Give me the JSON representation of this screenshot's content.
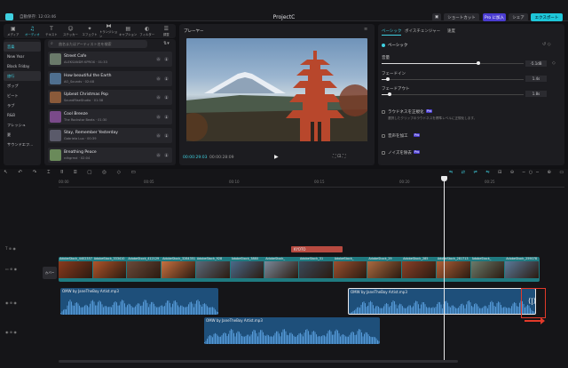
{
  "topbar": {
    "autosave": "自動保存: 12:03:46",
    "title": "ProjectC",
    "shortcut": "ショートカット",
    "pro": "Pro に加入",
    "share": "シェア",
    "export": "エクスポート"
  },
  "tools": [
    {
      "label": "メディア",
      "icon": "media-icon"
    },
    {
      "label": "オーディオ",
      "icon": "audio-icon"
    },
    {
      "label": "テキスト",
      "icon": "text-icon"
    },
    {
      "label": "ステッカー",
      "icon": "sticker-icon"
    },
    {
      "label": "エフェクト",
      "icon": "effect-icon"
    },
    {
      "label": "トランジション",
      "icon": "transition-icon"
    },
    {
      "label": "キャプション",
      "icon": "caption-icon"
    },
    {
      "label": "フィルター",
      "icon": "filter-icon"
    },
    {
      "label": "調整",
      "icon": "adjust-icon"
    }
  ],
  "categories": [
    "音楽",
    "New Year",
    "Black Friday",
    "旅行",
    "ポップ",
    "ビート",
    "ラブ",
    "R&B",
    "フレッシュ",
    "夏",
    "サウンドエフ..."
  ],
  "search_placeholder": "曲名またはアーティスト名を検索",
  "tracks": [
    {
      "title": "Street Cafe",
      "artist": "ALEKSANDR KPROX · 01:33",
      "color": "#6a7a6a"
    },
    {
      "title": "How beautiful the Earth",
      "artist": "AO_Sounds · 02:48",
      "color": "#4f6f8f"
    },
    {
      "title": "Upbeat Christmas Pop",
      "artist": "SoundRiseStudio · 01:38",
      "color": "#8a5a3a"
    },
    {
      "title": "Cool Breeze",
      "artist": "The Rockstar Beats · 01:30",
      "color": "#7a4a8a"
    },
    {
      "title": "Stay, Remember Yesterday",
      "artist": "Gabriela Luo · 00:39",
      "color": "#5a5a6a"
    },
    {
      "title": "Breathing Peace",
      "artist": "rdhgrmd · 02:04",
      "color": "#6a8a5a"
    }
  ],
  "player": {
    "title": "プレーヤー",
    "current": "00:00:29:03",
    "total": "00:00:28:09"
  },
  "props": {
    "tabs": [
      "ベーシック",
      "ボイスチェンジャー",
      "速度"
    ],
    "section": "ベーシック",
    "volume_label": "音量",
    "volume_value": "-5.1dB",
    "fadein_label": "フェードイン",
    "fadein_value": "1.4s",
    "fadeout_label": "フェードアウト",
    "fadeout_value": "1.8s",
    "ducking_label": "ラウドネスを正規化",
    "ducking_desc": "選択したクリップのラウドネスを標準レベルに正規化します。",
    "enhance_label": "音声を加工",
    "noise_label": "ノイズを除去",
    "pro_badge": "Pro"
  },
  "timeline": {
    "ruler": [
      "00:00",
      "00:05",
      "00:10",
      "00:15",
      "00:20",
      "00:25"
    ],
    "text_clip": "KYOTO",
    "cover_label": "カバー",
    "video_clips": [
      "AdobeStock_4402357",
      "AdobeStock_333410",
      "AdobeStock_412129",
      "AdobeStock_3284351",
      "AdobeStock_928",
      "AdobeStock_3880",
      "AdobeStock_",
      "AdobeStock_31",
      "AdobeStock_",
      "AdobeStock_29",
      "AdobeStock_285",
      "AdobeStock_281713",
      "AdobeStock_",
      "AdobeStock_259078"
    ],
    "audio_a": "OMW by JaneTheBoy Artist.mp3",
    "audio_b": "OMW by JaneTheBoy Artist.mp3",
    "audio_c": "OMW by JaneTheBoy Artist.mp3"
  }
}
